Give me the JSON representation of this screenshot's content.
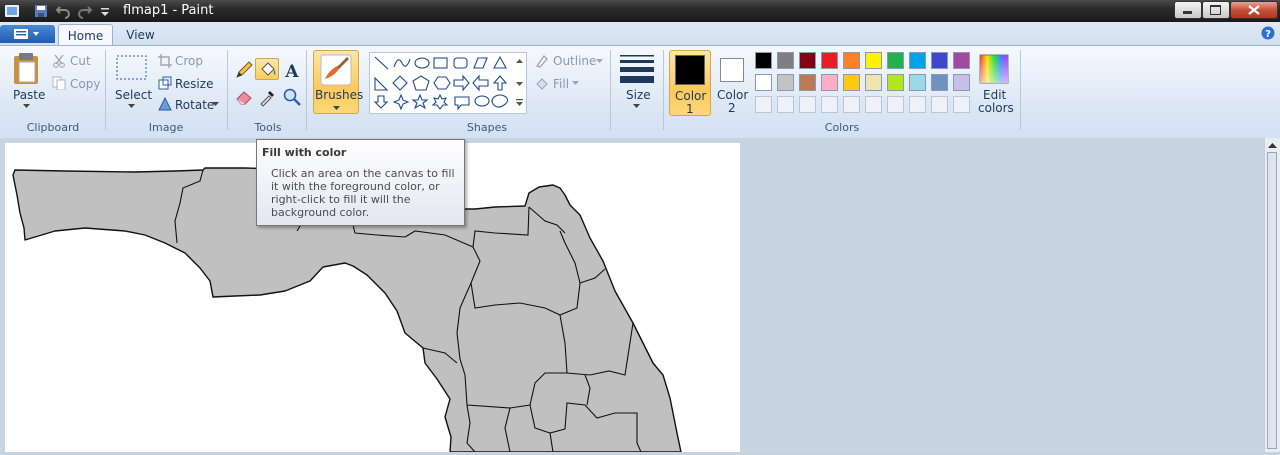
{
  "window": {
    "title": "flmap1 - Paint"
  },
  "tabs": [
    {
      "label": "Home"
    },
    {
      "label": "View"
    }
  ],
  "ribbon": {
    "clipboard": {
      "group_label": "Clipboard",
      "paste": "Paste",
      "cut": "Cut",
      "copy": "Copy"
    },
    "image": {
      "group_label": "Image",
      "select": "Select",
      "crop": "Crop",
      "resize": "Resize",
      "rotate": "Rotate"
    },
    "tools": {
      "group_label": "Tools"
    },
    "brushes": {
      "label": "Brushes"
    },
    "shapes": {
      "group_label": "Shapes",
      "outline": "Outline",
      "fill": "Fill"
    },
    "size": {
      "label": "Size"
    },
    "colors": {
      "group_label": "Colors",
      "color1_line1": "Color",
      "color1_line2": "1",
      "color2_line1": "Color",
      "color2_line2": "2",
      "edit_line1": "Edit",
      "edit_line2": "colors",
      "color1": "#000000",
      "color2": "#ffffff",
      "palette_row1": [
        "#000000",
        "#7f7f7f",
        "#880015",
        "#ed1c24",
        "#ff7f27",
        "#fff200",
        "#22b14c",
        "#00a2e8",
        "#3f48cc",
        "#a349a4"
      ],
      "palette_row2": [
        "#ffffff",
        "#c3c3c3",
        "#b97a57",
        "#ffaec9",
        "#ffc90e",
        "#efe4b0",
        "#b5e61d",
        "#99d9ea",
        "#7092be",
        "#c8bfe7"
      ]
    }
  },
  "tooltip": {
    "title": "Fill with color",
    "body": "Click an area on the canvas to fill it with the foreground color, or right-click to fill it will the background color."
  }
}
